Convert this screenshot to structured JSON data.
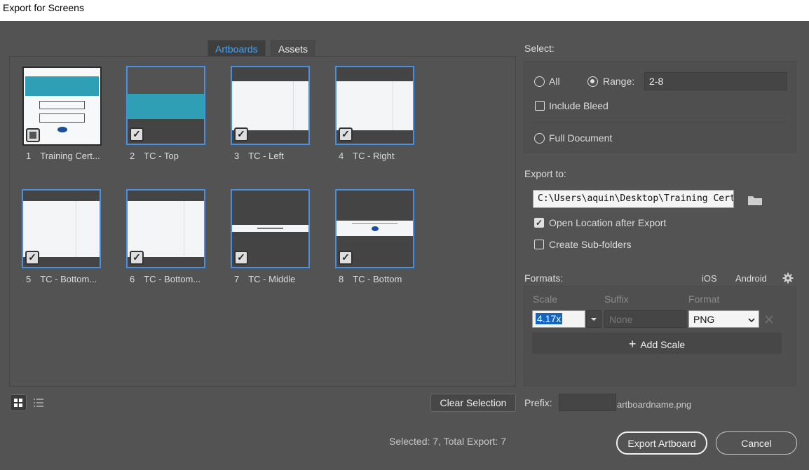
{
  "window": {
    "title": "Export for Screens"
  },
  "tabs": [
    {
      "label": "Artboards"
    },
    {
      "label": "Assets"
    }
  ],
  "artboards": [
    {
      "num": "1",
      "name": "Training Cert...",
      "selected": false
    },
    {
      "num": "2",
      "name": "TC - Top",
      "selected": true
    },
    {
      "num": "3",
      "name": "TC - Left",
      "selected": true
    },
    {
      "num": "4",
      "name": "TC - Right",
      "selected": true
    },
    {
      "num": "5",
      "name": "TC - Bottom...",
      "selected": true
    },
    {
      "num": "6",
      "name": "TC - Bottom...",
      "selected": true
    },
    {
      "num": "7",
      "name": "TC - Middle",
      "selected": true
    },
    {
      "num": "8",
      "name": "TC - Bottom",
      "selected": true
    }
  ],
  "left_bottom": {
    "clear_selection": "Clear Selection",
    "status": "Selected: 7, Total Export: 7"
  },
  "select": {
    "heading": "Select:",
    "all": "All",
    "range": "Range:",
    "range_value": "2-8",
    "include_bleed": "Include Bleed",
    "full_document": "Full Document",
    "mode": "range"
  },
  "export_to": {
    "heading": "Export to:",
    "path": "C:\\Users\\aquin\\Desktop\\Training Certificate",
    "open_location": "Open Location after Export",
    "open_location_checked": true,
    "create_subfolders": "Create Sub-folders",
    "create_subfolders_checked": false
  },
  "formats": {
    "heading": "Formats:",
    "ios": "iOS",
    "android": "Android",
    "col_scale": "Scale",
    "col_suffix": "Suffix",
    "col_format": "Format",
    "scale_value": "4.17x",
    "suffix_placeholder": "None",
    "format_value": "PNG",
    "add_scale": "Add Scale"
  },
  "prefix": {
    "label": "Prefix:",
    "suffix_text": "artboardname.png"
  },
  "actions": {
    "export": "Export Artboard",
    "cancel": "Cancel"
  },
  "colors": {
    "accent": "#4a90e2",
    "panel": "#535353",
    "tab_active_text": "#4aa3ef"
  }
}
